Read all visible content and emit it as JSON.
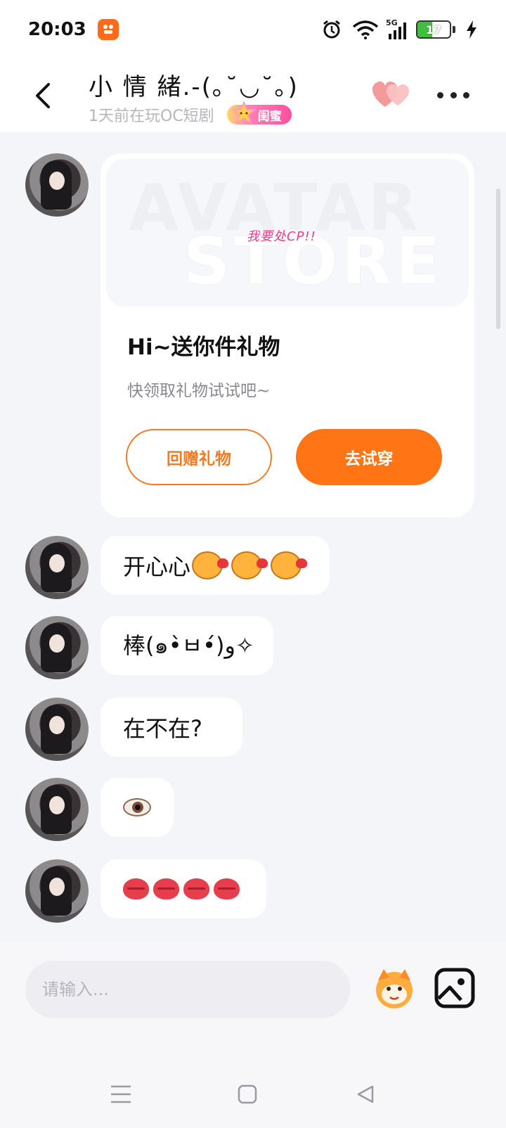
{
  "status_bar": {
    "time": "20:03",
    "network": "5G",
    "battery": "17"
  },
  "header": {
    "contact_name": "小 情 緒.-(｡˘◡˘｡)",
    "status_text": "1天前在玩OC短剧",
    "relation_badge": "闺蜜"
  },
  "gift_card": {
    "image_text_1": "AVATAR",
    "image_text_2": "STORE",
    "image_tagline": "我要处CP!!",
    "title": "Hi~送你件礼物",
    "description": "快领取礼物试试吧~",
    "return_button": "回赠礼物",
    "try_button": "去试穿"
  },
  "messages": [
    {
      "text": "开心心"
    },
    {
      "text": "棒(๑•̀ㅂ•́)و✧"
    },
    {
      "text": "在不在?"
    },
    {
      "text": "👁️"
    },
    {
      "text": ""
    }
  ],
  "input": {
    "placeholder": "请输入..."
  },
  "colors": {
    "accent": "#ff7414",
    "accent_border": "#f07b22",
    "background": "#f4f5f9",
    "badge_pink": "#ff4fa0"
  },
  "icons": [
    "back-arrow-icon",
    "hearts-icon",
    "more-icon",
    "star-icon",
    "sticker-icon",
    "image-icon",
    "menu-icon",
    "home-icon",
    "back-nav-icon"
  ]
}
